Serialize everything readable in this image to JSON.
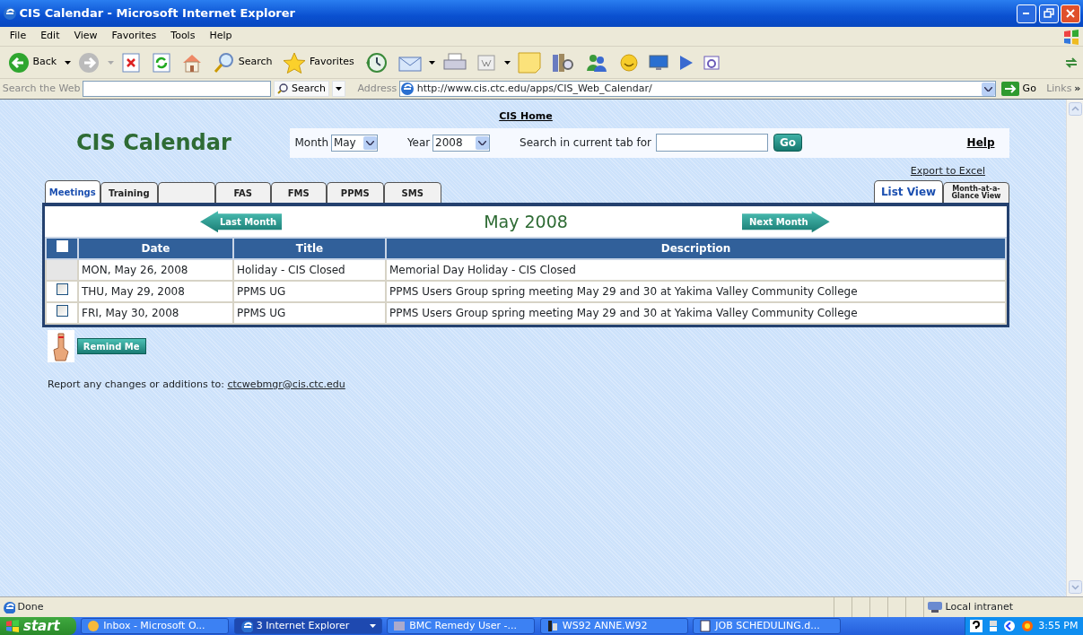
{
  "window": {
    "title": "CIS Calendar - Microsoft Internet Explorer"
  },
  "menu": [
    "File",
    "Edit",
    "View",
    "Favorites",
    "Tools",
    "Help"
  ],
  "toolbar": {
    "back": "Back",
    "search": "Search",
    "favorites": "Favorites"
  },
  "search_bar": {
    "label": "Search the Web",
    "button": "Search"
  },
  "address_bar": {
    "label": "Address",
    "url": "http://www.cis.ctc.edu/apps/CIS_Web_Calendar/",
    "go": "Go",
    "links": "Links",
    "more": "»"
  },
  "page": {
    "home_link": "CIS Home",
    "heading": "CIS Calendar",
    "month": {
      "label": "Month",
      "value": "May"
    },
    "year": {
      "label": "Year",
      "value": "2008"
    },
    "search": {
      "label": "Search in current tab for",
      "button": "Go"
    },
    "help": "Help",
    "export": "Export to Excel",
    "tabs": [
      {
        "label": "Meetings",
        "selected": true
      },
      {
        "label": "Training",
        "selected": false
      },
      {
        "selected": false
      },
      {
        "label": "FAS",
        "selected": false
      },
      {
        "label": "FMS",
        "selected": false
      },
      {
        "label": "PPMS",
        "selected": false
      },
      {
        "label": "SMS",
        "selected": false
      }
    ],
    "view_tabs": [
      {
        "label": "List View",
        "selected": true
      },
      {
        "label": "Month-at-a-Glance View",
        "selected": false
      }
    ],
    "prev": "Last Month",
    "month_title": "May 2008",
    "next": "Next Month",
    "table": {
      "select_all": false,
      "columns": [
        "Date",
        "Title",
        "Description"
      ],
      "rows": [
        {
          "kind": "blank",
          "cells": [
            "MON, May 26, 2008",
            "Holiday - CIS Closed",
            "Memorial Day Holiday - CIS Closed"
          ]
        },
        {
          "kind": "checkbox",
          "checked": false,
          "cells": [
            "THU, May 29, 2008",
            "PPMS UG",
            "PPMS Users Group spring meeting May 29 and 30 at Yakima Valley Community College"
          ]
        },
        {
          "kind": "checkbox",
          "checked": false,
          "cells": [
            "FRI, May 30, 2008",
            "PPMS UG",
            "PPMS Users Group spring meeting May 29 and 30 at Yakima Valley Community College"
          ]
        }
      ]
    },
    "remind": "Remind Me",
    "report": "Report any changes or additions to:",
    "email": "ctcwebmgr@cis.ctc.edu"
  },
  "status_bar": {
    "text": "Done",
    "zone": "Local intranet"
  },
  "taskbar": {
    "start": "start",
    "items": [
      {
        "label": "Inbox - Microsoft O...",
        "selected": false
      },
      {
        "label": "3 Internet Explorer",
        "selected": true
      },
      {
        "label": "BMC Remedy User -...",
        "selected": false
      },
      {
        "label": "WS92 ANNE.W92",
        "selected": false
      },
      {
        "label": "JOB SCHEDULING.d...",
        "selected": false
      }
    ],
    "clock": "3:55 PM"
  }
}
